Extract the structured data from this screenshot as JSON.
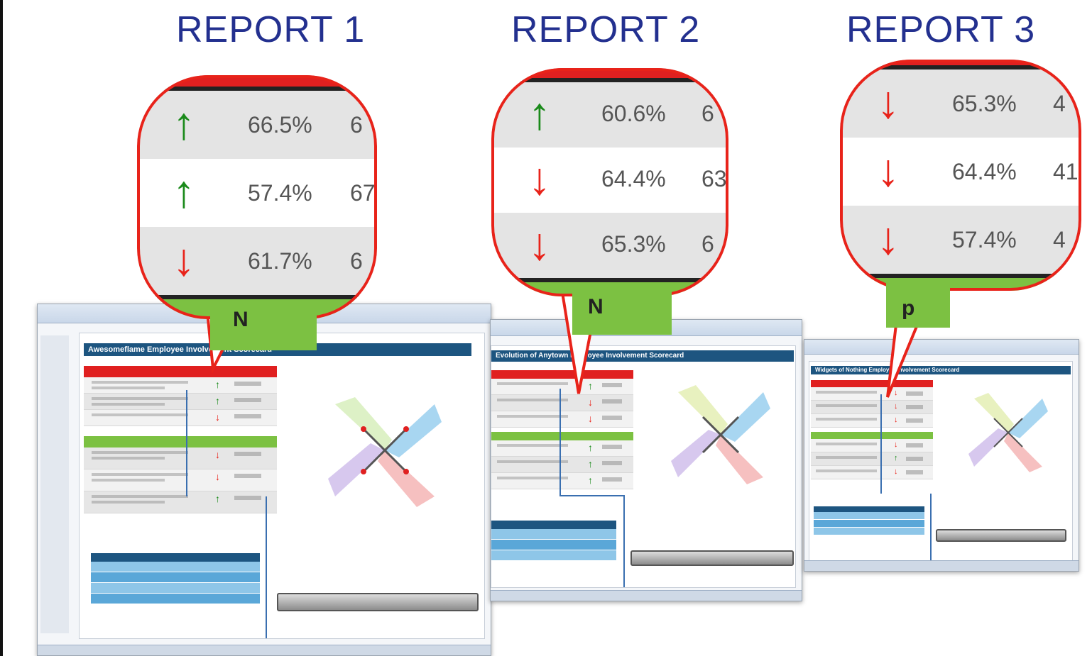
{
  "reports": [
    {
      "title": "REPORT 1",
      "window_banner": "Awesomeflame Employee Involvement Scorecard",
      "zoom_rows": [
        {
          "direction": "up",
          "value": "66.5%",
          "trailing": "6"
        },
        {
          "direction": "up",
          "value": "57.4%",
          "trailing": "67"
        },
        {
          "direction": "down",
          "value": "61.7%",
          "trailing": "6"
        }
      ],
      "zoom_footer": "N"
    },
    {
      "title": "REPORT 2",
      "window_banner": "Evolution of Anytown Employee Involvement Scorecard",
      "zoom_rows": [
        {
          "direction": "up",
          "value": "60.6%",
          "trailing": "6"
        },
        {
          "direction": "down",
          "value": "64.4%",
          "trailing": "63"
        },
        {
          "direction": "down",
          "value": "65.3%",
          "trailing": "6"
        }
      ],
      "zoom_footer": "N"
    },
    {
      "title": "REPORT 3",
      "window_banner": "Widgets of Nothing Employee Involvement Scorecard",
      "zoom_rows": [
        {
          "direction": "down",
          "value": "65.3%",
          "trailing": "4"
        },
        {
          "direction": "down",
          "value": "64.4%",
          "trailing": "41"
        },
        {
          "direction": "down",
          "value": "57.4%",
          "trailing": "4"
        }
      ],
      "zoom_footer": "p"
    }
  ],
  "icons": {
    "up": "arrow-up-icon",
    "down": "arrow-down-icon"
  },
  "colors": {
    "title": "#23308f",
    "up": "#1a8a1a",
    "down": "#e8231a",
    "callout_border": "#e8231a",
    "green_band": "#7cc142",
    "red_band": "#e02020"
  }
}
